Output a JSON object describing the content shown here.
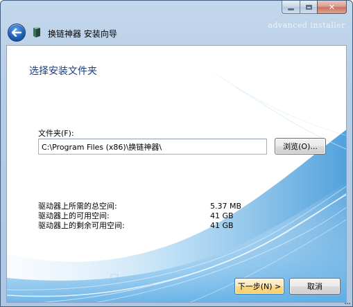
{
  "window": {
    "title": "换链神器 安装向导",
    "watermark": "advanced installer",
    "caption_buttons": {
      "minimize_icon": "minimize-icon",
      "maximize_icon": "maximize-icon",
      "close_label": "✕"
    }
  },
  "page": {
    "heading": "选择安装文件夹",
    "folder_label": "文件夹(F):",
    "folder_value": "C:\\Program Files (x86)\\换链神器\\",
    "browse_label": "浏览(O)..."
  },
  "disk_space": [
    {
      "label": "驱动器上所需的总空间:",
      "value": "5.37 MB"
    },
    {
      "label": "驱动器上的可用空间:",
      "value": "41 GB"
    },
    {
      "label": "驱动器上的剩余可用空间:",
      "value": "41 GB"
    }
  ],
  "footer": {
    "next_label": "下一步(N) >",
    "cancel_label": "取消"
  },
  "colors": {
    "heading": "#1a3d7c",
    "frame": "#b7cde6",
    "swoosh": "#4aa3de"
  }
}
